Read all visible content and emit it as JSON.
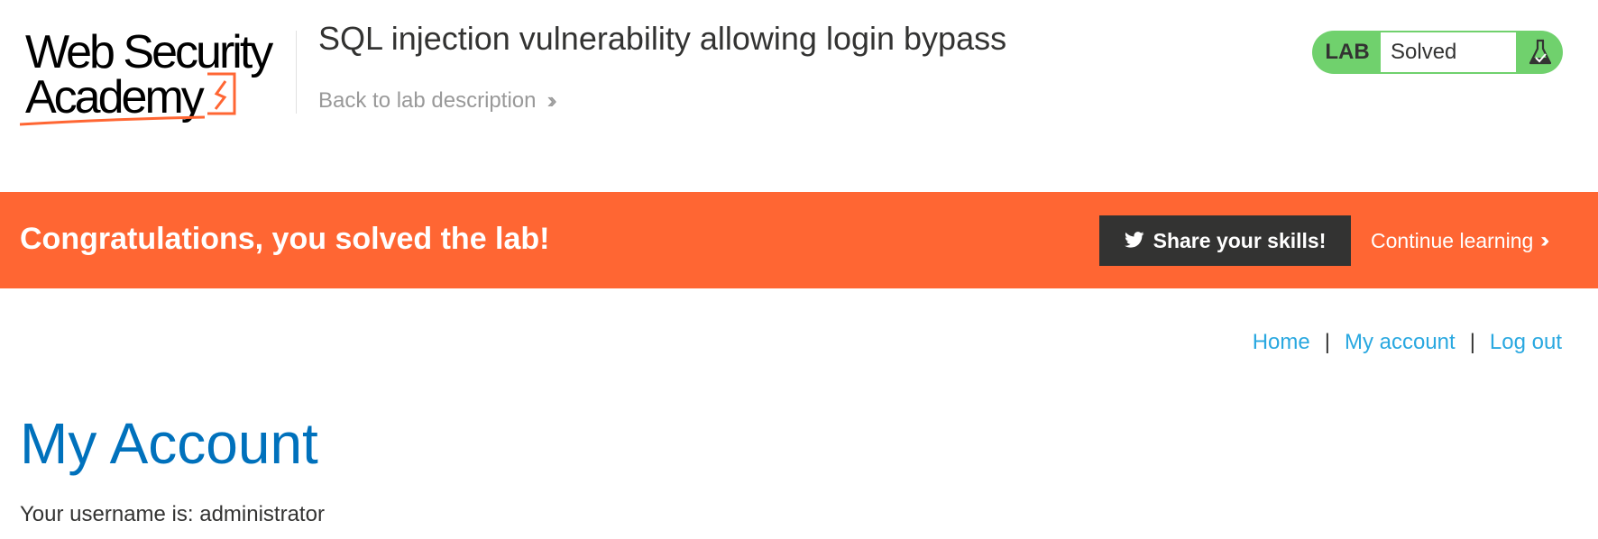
{
  "header": {
    "logo_line1": "Web Security",
    "logo_line2": "Academy",
    "lab_title": "SQL injection vulnerability allowing login bypass",
    "back_link": "Back to lab description",
    "status": {
      "tag": "LAB",
      "state": "Solved",
      "accent_color": "#70d16d"
    }
  },
  "banner": {
    "message": "Congratulations, you solved the lab!",
    "share_button": "Share your skills!",
    "continue_link": "Continue learning",
    "background_color": "#ff6633"
  },
  "nav": {
    "items": [
      {
        "label": "Home"
      },
      {
        "label": "My account"
      },
      {
        "label": "Log out"
      }
    ],
    "separator": "|"
  },
  "main": {
    "title": "My Account",
    "username_label": "Your username is: administrator"
  },
  "icons": {
    "logo": "web-security-academy-logo",
    "back": "double-chevron-right-icon",
    "flask": "flask-check-icon",
    "twitter": "twitter-bird-icon",
    "continue": "double-chevron-right-icon"
  }
}
